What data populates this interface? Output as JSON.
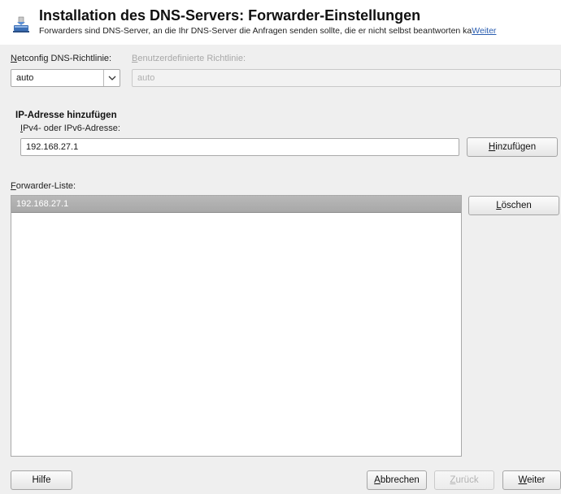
{
  "header": {
    "title": "Installation des DNS-Servers: Forwarder-Einstellungen",
    "description": "Forwarders sind DNS-Server, an die Ihr DNS-Server die Anfragen senden sollte, die er nicht selbst beantworten ka",
    "more_link": "Weiter",
    "icon": "dns-server-install-icon"
  },
  "policy": {
    "netconfig_label": "Netconfig DNS-Richtlinie:",
    "netconfig_value": "auto",
    "custom_label": "Benutzerdefinierte Richtlinie:",
    "custom_value": "auto"
  },
  "add_section": {
    "title": "IP-Adresse hinzufügen",
    "address_label": "IPv4- oder IPv6-Adresse:",
    "address_value": "192.168.27.1",
    "add_button": "Hinzufügen"
  },
  "forwarder_list": {
    "label": "Forwarder-Liste:",
    "items": [
      "192.168.27.1"
    ],
    "selected_index": 0,
    "delete_button": "Löschen"
  },
  "footer": {
    "help": "Hilfe",
    "cancel": "Abbrechen",
    "back": "Zurück",
    "next": "Weiter"
  },
  "colors": {
    "link": "#2a5db0",
    "selection": "#a8a8a8",
    "window_bg": "#efefef"
  }
}
